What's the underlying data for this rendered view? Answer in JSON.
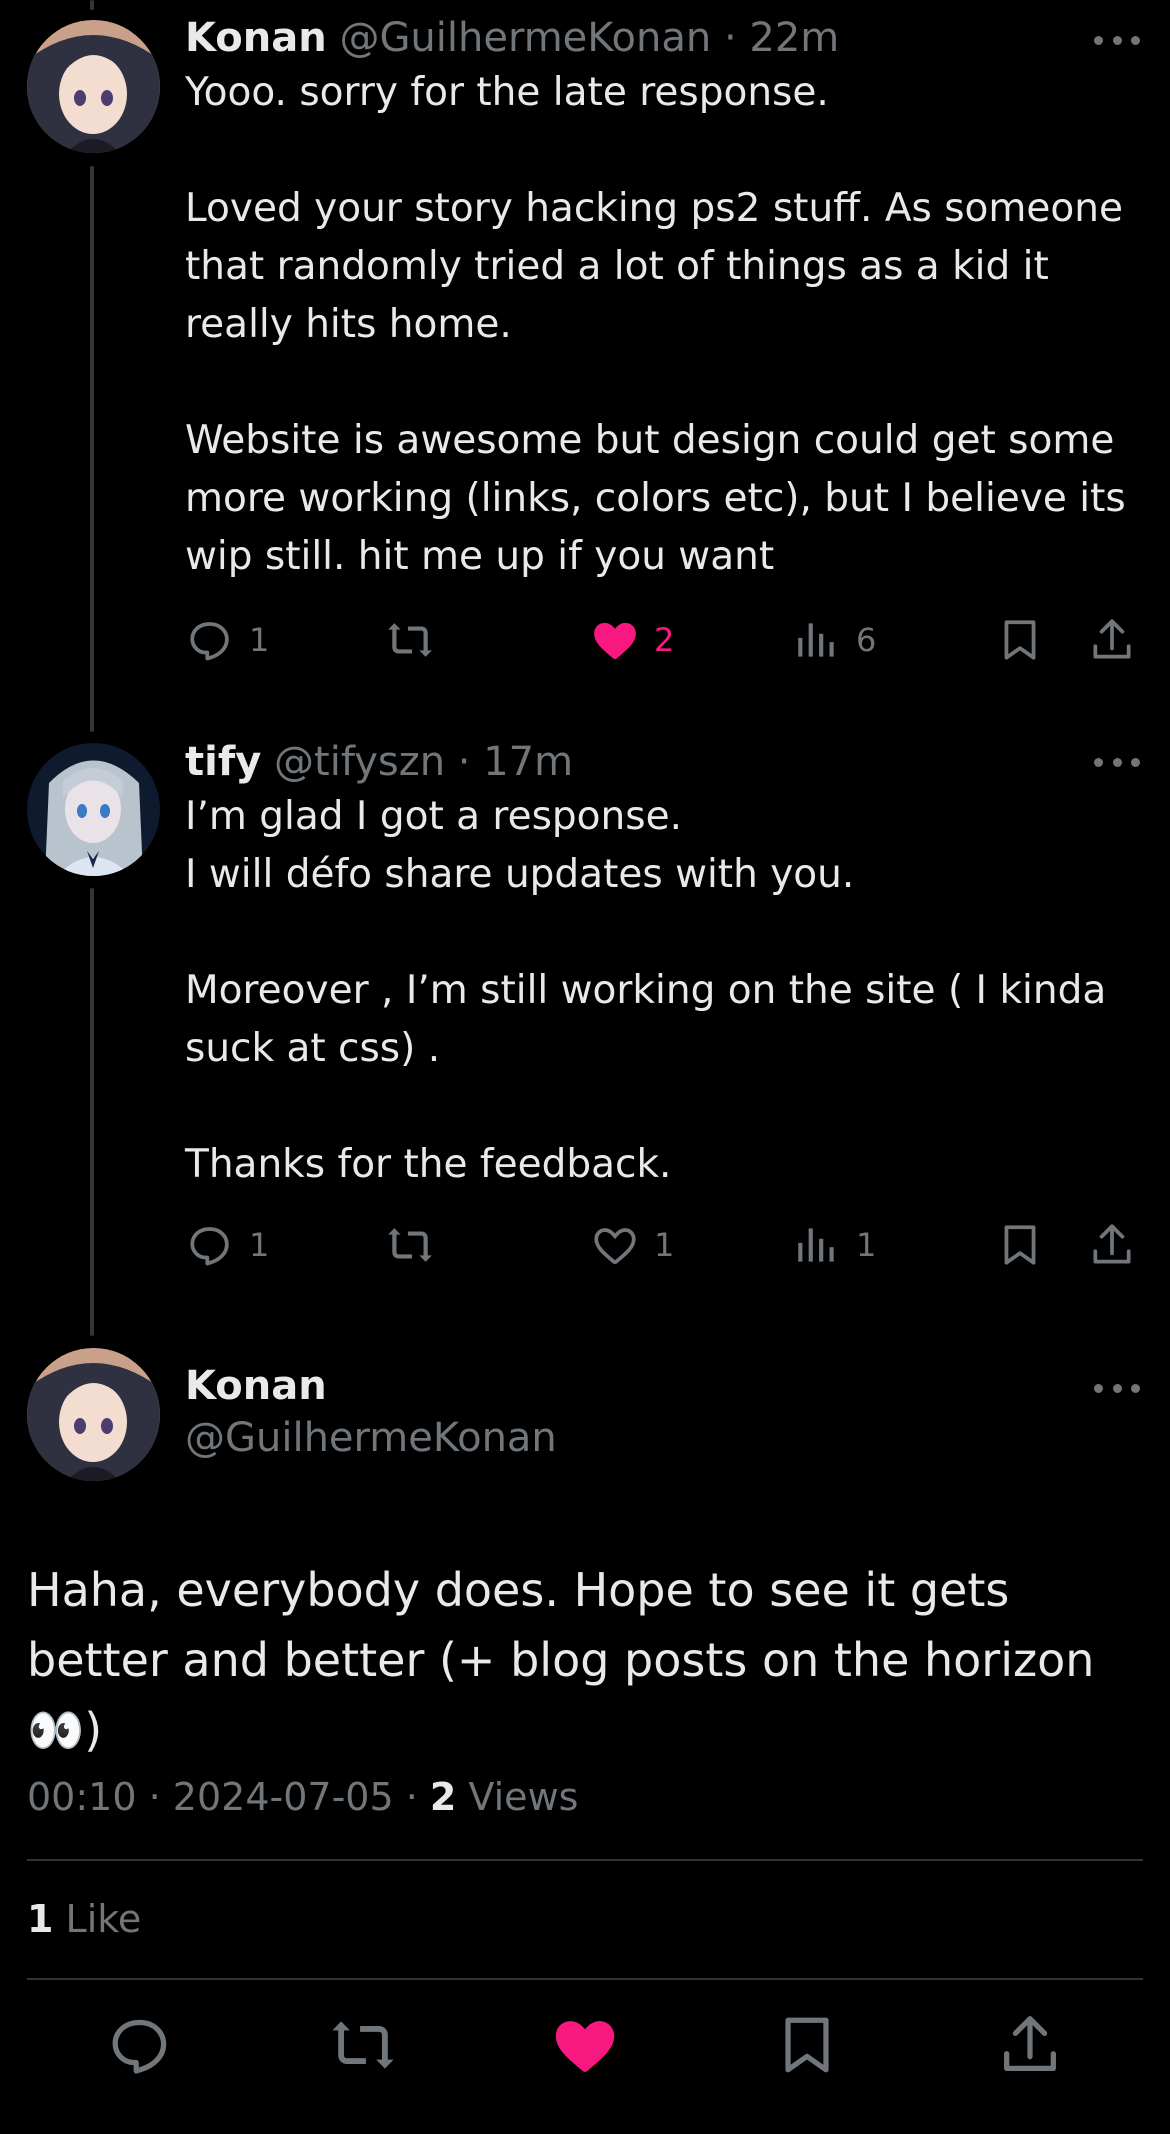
{
  "colors": {
    "background": "#000000",
    "text": "#e7e9ea",
    "muted": "#71767b",
    "like": "#f91880",
    "divider": "#2f3336"
  },
  "replies": [
    {
      "name": "Konan",
      "handle": "@GuilhermeKonan",
      "sep": "·",
      "time": "22m",
      "text": "Yooo. sorry for the late response.\n\nLoved your story hacking ps2 stuff. As someone that randomly tried a lot of things as a kid it really hits home.\n\nWebsite is awesome but design could get some more working (links, colors etc), but I believe its wip still. hit me up if you want",
      "reply_count": "1",
      "like_count": "2",
      "view_count": "6",
      "liked": true
    },
    {
      "name": "tify",
      "handle": "@tifyszn",
      "sep": "·",
      "time": "17m",
      "text": "I’m glad I got a response.\nI will défo share updates with you.\n\nMoreover , I’m still working on the site ( I kinda suck at css) .\n\nThanks for the feedback.",
      "reply_count": "1",
      "like_count": "1",
      "view_count": "1",
      "liked": false
    }
  ],
  "main_tweet": {
    "name": "Konan",
    "handle": "@GuilhermeKonan",
    "text": "Haha, everybody does. Hope to see it gets better and better (+ blog posts on the horizon 👀)",
    "time": "00:10",
    "sep": "·",
    "date": "2024-07-05",
    "views_count": "2",
    "views_label": "Views",
    "likes_count": "1",
    "likes_label": "Like",
    "liked": true
  },
  "icons": [
    "reply-icon",
    "retweet-icon",
    "heart-icon",
    "analytics-icon",
    "bookmark-icon",
    "share-icon",
    "more-icon",
    "avatar"
  ]
}
